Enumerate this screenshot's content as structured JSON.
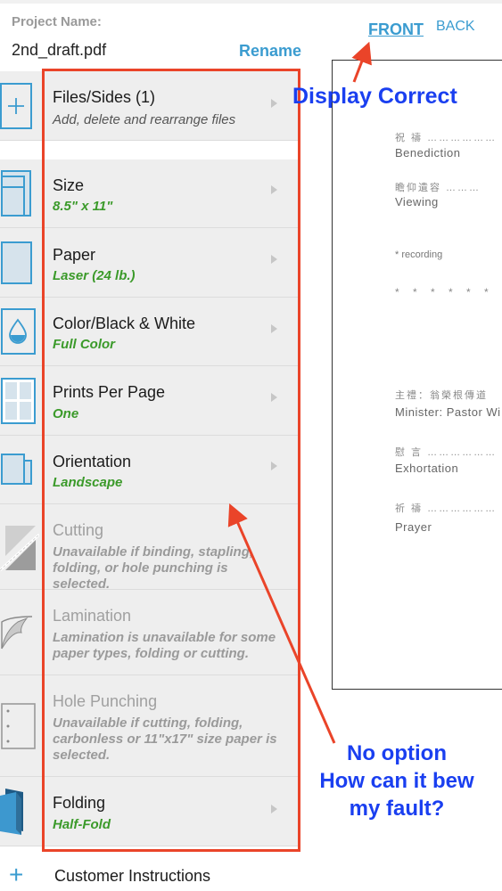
{
  "project": {
    "label": "Project Name:",
    "name": "2nd_draft.pdf",
    "rename_label": "Rename"
  },
  "preview_tabs": {
    "front": "FRONT",
    "back": "BACK",
    "active": "FRONT"
  },
  "options": [
    {
      "id": "files",
      "title": "Files/Sides  (1)",
      "subtitle": "Add, delete and rearrange files",
      "icon": "add-file-icon",
      "enabled": true
    },
    {
      "id": "size",
      "title": "Size",
      "subtitle": "8.5\" x 11\"",
      "icon": "paper-size-icon",
      "enabled": true
    },
    {
      "id": "paper",
      "title": "Paper",
      "subtitle": "Laser (24 lb.)",
      "icon": "paper-icon",
      "enabled": true
    },
    {
      "id": "color",
      "title": "Color/Black & White",
      "subtitle": "Full Color",
      "icon": "ink-drop-icon",
      "enabled": true
    },
    {
      "id": "prints",
      "title": "Prints Per Page",
      "subtitle": "One",
      "icon": "grid-icon",
      "enabled": true
    },
    {
      "id": "orientation",
      "title": "Orientation",
      "subtitle": "Landscape",
      "icon": "orientation-icon",
      "enabled": true
    },
    {
      "id": "cutting",
      "title": "Cutting",
      "subtitle": "Unavailable if binding, stapling, folding, or hole punching is selected.",
      "icon": "cutting-icon",
      "enabled": false
    },
    {
      "id": "lamination",
      "title": "Lamination",
      "subtitle": "Lamination is unavailable for some paper types, folding or cutting.",
      "icon": "lamination-icon",
      "enabled": false
    },
    {
      "id": "holepunch",
      "title": "Hole Punching",
      "subtitle": "Unavailable if cutting, folding, carbonless or 11\"x17\" size paper is selected.",
      "icon": "hole-punch-icon",
      "enabled": false
    },
    {
      "id": "folding",
      "title": "Folding",
      "subtitle": "Half-Fold",
      "icon": "folding-icon",
      "enabled": true
    }
  ],
  "customer_instructions": {
    "label": "Customer Instructions",
    "icon": "plus-icon"
  },
  "preview_document": {
    "lines": [
      {
        "cn": "祝 禱 ………………",
        "en": "Benediction"
      },
      {
        "cn": "瞻仰遺容 ………",
        "en": "Viewing"
      },
      {
        "note": "* recording"
      },
      {
        "stars": "* * * * * * * * * *"
      },
      {
        "cn": "主禮：翁榮根傳道",
        "en": "Minister: Pastor Wi"
      },
      {
        "cn": "慰 言 ………………",
        "en": "Exhortation"
      },
      {
        "cn": "祈 禱 ………………",
        "en": "Prayer"
      }
    ]
  },
  "annotations": {
    "top": "Display Correct",
    "bottom_line1": "No option",
    "bottom_line2": "How can it bew",
    "bottom_line3": "my fault?",
    "text_color": "#1a3ff0",
    "arrow_color": "#ea4429"
  },
  "colors": {
    "accent": "#3b9cd0",
    "selected_value": "#3b9a2a",
    "disabled": "#9a9a9a",
    "row_bg": "#eeeeee"
  }
}
